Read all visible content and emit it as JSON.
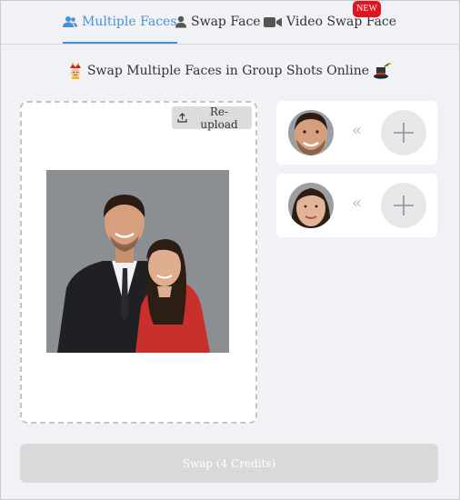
{
  "tabs": [
    {
      "label": "Multiple Faces",
      "active": true,
      "icon": "users-icon"
    },
    {
      "label": "Swap Face",
      "active": false,
      "icon": "user-icon"
    },
    {
      "label": "Video Swap Face",
      "active": false,
      "icon": "video-camera-icon",
      "badge": "NEW"
    }
  ],
  "heading": {
    "text": "Swap Multiple Faces in Group Shots Online",
    "left_icon": "jester-emoji-icon",
    "right_icon": "magic-hat-emoji-icon"
  },
  "upload": {
    "reupload_label": "Re-upload",
    "reupload_icon": "upload-icon"
  },
  "faces": [
    {
      "detected": "man-face",
      "separator": "«",
      "add_icon": "plus-icon"
    },
    {
      "detected": "woman-face",
      "separator": "«",
      "add_icon": "plus-icon"
    }
  ],
  "swap_button": {
    "label": "Swap (4 Credits)",
    "enabled": false
  },
  "colors": {
    "accent": "#4a90d9",
    "badge": "#e0141e",
    "background": "#f1f2f6",
    "disabled_button": "#d9d9d9"
  }
}
